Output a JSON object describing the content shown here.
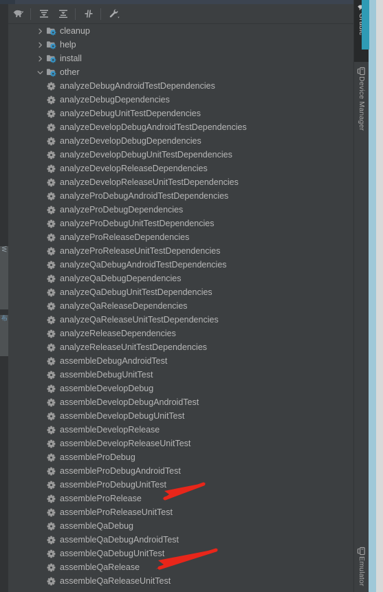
{
  "window": {
    "tool_window_title": "Gradle"
  },
  "toolbar": {
    "buttons": [
      {
        "name": "gradle-elephant-icon",
        "label": "Gradle",
        "icon": "elephant-icon"
      },
      {
        "name": "expand-all-button",
        "label": "Expand All",
        "icon": "expand-all-icon"
      },
      {
        "name": "collapse-all-button",
        "label": "Collapse All",
        "icon": "collapse-all-icon"
      },
      {
        "name": "toggle-offline-button",
        "label": "Toggle Offline Mode",
        "icon": "offline-mode-icon"
      },
      {
        "name": "settings-button",
        "label": "Gradle Settings",
        "icon": "wrench-icon"
      }
    ]
  },
  "tree": {
    "folders": [
      {
        "label": "cleanup",
        "expanded": false,
        "icon": "gradle-folder-icon"
      },
      {
        "label": "help",
        "expanded": false,
        "icon": "gradle-folder-icon"
      },
      {
        "label": "install",
        "expanded": false,
        "icon": "gradle-folder-icon"
      },
      {
        "label": "other",
        "expanded": true,
        "icon": "gradle-folder-icon"
      }
    ],
    "tasks": [
      "analyzeDebugAndroidTestDependencies",
      "analyzeDebugDependencies",
      "analyzeDebugUnitTestDependencies",
      "analyzeDevelopDebugAndroidTestDependencies",
      "analyzeDevelopDebugDependencies",
      "analyzeDevelopDebugUnitTestDependencies",
      "analyzeDevelopReleaseDependencies",
      "analyzeDevelopReleaseUnitTestDependencies",
      "analyzeProDebugAndroidTestDependencies",
      "analyzeProDebugDependencies",
      "analyzeProDebugUnitTestDependencies",
      "analyzeProReleaseDependencies",
      "analyzeProReleaseUnitTestDependencies",
      "analyzeQaDebugAndroidTestDependencies",
      "analyzeQaDebugDependencies",
      "analyzeQaDebugUnitTestDependencies",
      "analyzeQaReleaseDependencies",
      "analyzeQaReleaseUnitTestDependencies",
      "analyzeReleaseDependencies",
      "analyzeReleaseUnitTestDependencies",
      "assembleDebugAndroidTest",
      "assembleDebugUnitTest",
      "assembleDevelopDebug",
      "assembleDevelopDebugAndroidTest",
      "assembleDevelopDebugUnitTest",
      "assembleDevelopRelease",
      "assembleDevelopReleaseUnitTest",
      "assembleProDebug",
      "assembleProDebugAndroidTest",
      "assembleProDebugUnitTest",
      "assembleProRelease",
      "assembleProReleaseUnitTest",
      "assembleQaDebug",
      "assembleQaDebugAndroidTest",
      "assembleQaDebugUnitTest",
      "assembleQaRelease",
      "assembleQaReleaseUnitTest"
    ],
    "task_icon": "gear-icon"
  },
  "annotations": {
    "arrows": [
      {
        "name": "arrow-assemble-pro-release",
        "target": "assembleProRelease",
        "color": "#e8261a"
      },
      {
        "name": "arrow-assemble-qa-release",
        "target": "assembleQaRelease",
        "color": "#e8261a"
      }
    ]
  },
  "right_tool_bar": {
    "tabs": [
      {
        "label": "Gradle",
        "icon": "elephant-icon",
        "active": true
      },
      {
        "label": "Device Manager",
        "icon": "device-icon",
        "active": false
      },
      {
        "label": "Emulator",
        "icon": "device-icon",
        "active": false
      }
    ]
  },
  "left_tool_bar": {
    "tabs": [
      {
        "label": "W",
        "icon": ""
      },
      {
        "label": "布",
        "icon": ""
      }
    ]
  },
  "colors": {
    "background": "#3c3f41",
    "text": "#bbbbbb",
    "folder_accent": "#3592c4",
    "arrow_red": "#e8261a",
    "scrollbar": "#5c5f61"
  }
}
